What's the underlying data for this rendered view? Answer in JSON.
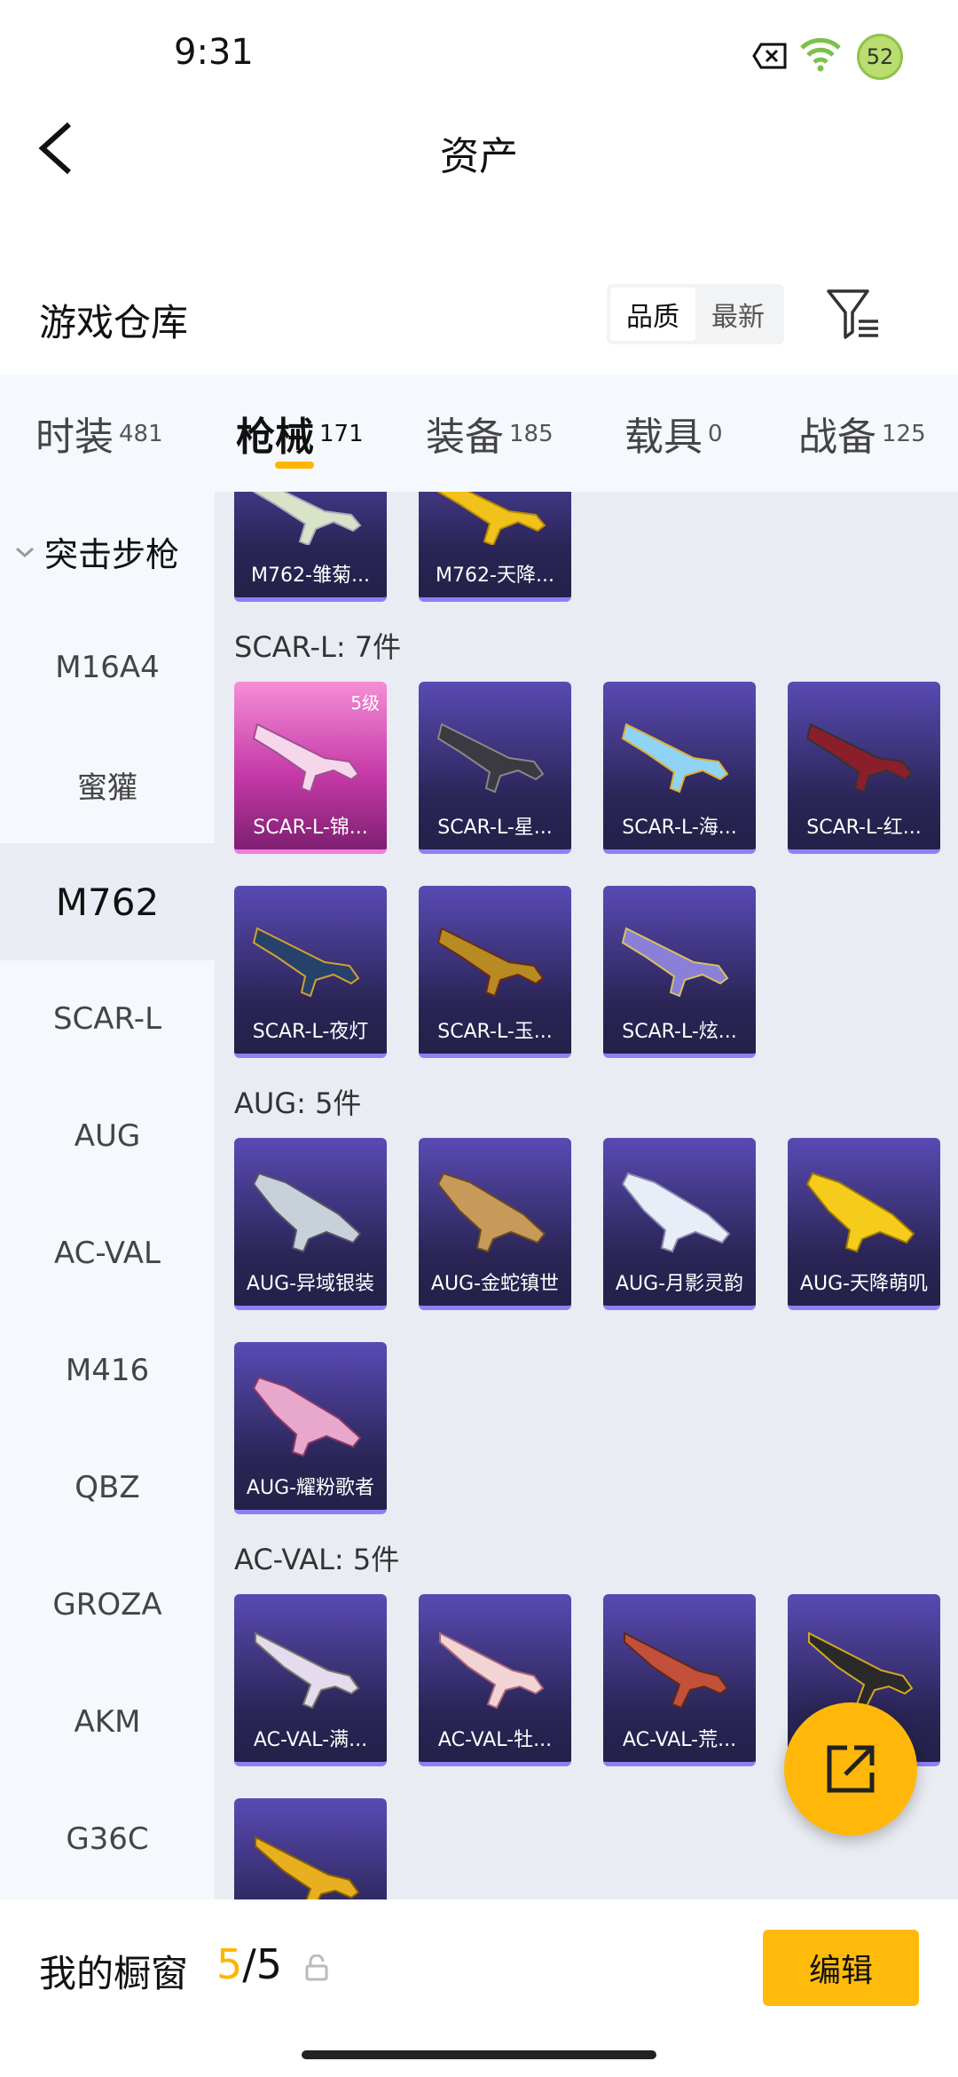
{
  "status": {
    "time": "9:31",
    "battery": "52"
  },
  "header": {
    "title": "资产"
  },
  "warehouse": {
    "title": "游戏仓库",
    "sort_options": [
      "品质",
      "最新"
    ],
    "sort_selected": "品质"
  },
  "tabs": [
    {
      "label": "时装",
      "count": "481"
    },
    {
      "label": "枪械",
      "count": "171",
      "active": true
    },
    {
      "label": "装备",
      "count": "185"
    },
    {
      "label": "载具",
      "count": "0"
    },
    {
      "label": "战备",
      "count": "125"
    }
  ],
  "sidebar": {
    "category": "突击步枪",
    "items": [
      "M16A4",
      "蜜獾",
      "M762",
      "SCAR-L",
      "AUG",
      "AC-VAL",
      "M416",
      "QBZ",
      "GROZA",
      "AKM",
      "G36C"
    ],
    "active": "M762"
  },
  "sections": {
    "m762": {
      "items": [
        "M762-雏菊...",
        "M762-天降..."
      ]
    },
    "scar": {
      "title": "SCAR-L: 7件",
      "level_badge": "5级",
      "items": [
        "SCAR-L-锦...",
        "SCAR-L-星...",
        "SCAR-L-海...",
        "SCAR-L-红...",
        "SCAR-L-夜灯",
        "SCAR-L-玉...",
        "SCAR-L-炫..."
      ]
    },
    "aug": {
      "title": "AUG: 5件",
      "items": [
        "AUG-异域银装",
        "AUG-金蛇镇世",
        "AUG-月影灵韵",
        "AUG-天降萌叽",
        "AUG-耀粉歌者"
      ]
    },
    "acval": {
      "title": "AC-VAL: 5件",
      "items": [
        "AC-VAL-满...",
        "AC-VAL-牡...",
        "AC-VAL-荒...",
        ""
      ]
    }
  },
  "colors": {
    "accent": "#ffb400",
    "card_gradient_top": "#5a4ab4",
    "card_gradient_bottom": "#232048",
    "pink_card": "#c63aa8"
  },
  "bottom": {
    "vitrine_label": "我的橱窗",
    "used": "5",
    "total": "/5",
    "edit_label": "编辑"
  },
  "icons": {
    "back": "chevron-left-icon",
    "filter": "filter-icon",
    "share": "share-icon",
    "lock": "lock-icon"
  }
}
